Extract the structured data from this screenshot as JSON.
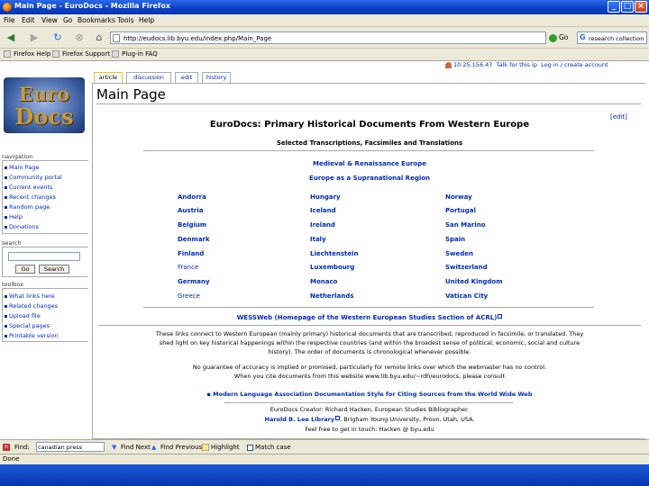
{
  "window": {
    "title": "Main Page - EuroDocs - Mozilla Firefox"
  },
  "menubar": [
    "File",
    "Edit",
    "View",
    "Go",
    "Bookmarks",
    "Tools",
    "Help"
  ],
  "navbar": {
    "url": "http://eudocs.lib.byu.edu/index.php/Main_Page",
    "go_label": "Go",
    "search_value": "research collections"
  },
  "bookmarks": [
    "Firefox Help",
    "Firefox Support",
    "Plug-in FAQ"
  ],
  "userbar": {
    "ip": "10.25.156.47",
    "talk": "Talk for this ip",
    "login": "Log in / create account"
  },
  "tabs": [
    "article",
    "discussion",
    "edit",
    "history"
  ],
  "logo": {
    "line1": "Euro",
    "line2": "Docs"
  },
  "sidebar": {
    "navigation_title": "navigation",
    "navigation": [
      "Main Page",
      "Community portal",
      "Current events",
      "Recent changes",
      "Random page",
      "Help",
      "Donations"
    ],
    "search_title": "search",
    "go_button": "Go",
    "search_button": "Search",
    "toolbox_title": "toolbox",
    "toolbox": [
      "What links here",
      "Related changes",
      "Upload file",
      "Special pages",
      "Printable version"
    ]
  },
  "main": {
    "page_title": "Main Page",
    "edit": "[edit]",
    "heading": "EuroDocs: Primary Historical Documents From Western Europe",
    "subheading": "Selected Transcriptions, Facsimiles and Translations",
    "period_link": "Medieval & Renaissance Europe",
    "supranational_link": "Europe as a Supranational Region",
    "countries": [
      [
        "Andorra",
        "Hungary",
        "Norway"
      ],
      [
        "Austria",
        "Iceland",
        "Portugal"
      ],
      [
        "Belgium",
        "Ireland",
        "San Marino"
      ],
      [
        "Denmark",
        "Italy",
        "Spain"
      ],
      [
        "Finland",
        "Liechtenstein",
        "Sweden"
      ],
      [
        "France",
        "Luxembourg",
        "Switzerland"
      ],
      [
        "Germany",
        "Monaco",
        "United Kingdom"
      ],
      [
        "Greece",
        "Netherlands",
        "Vatican City"
      ]
    ],
    "wess_link": "WESSWeb",
    "wess_text": " (Homepage of the Western European Studies Section of ACRL)",
    "para1": [
      "These links connect to Western European (mainly primary) historical documents that are transcribed, reproduced in facsimile, or translated. They",
      "shed light on key historical happenings within the respective countries (and within the broadest sense of political, economic, social and culture",
      "history). The order of documents is chronological whenever possible."
    ],
    "para2": [
      "No guarantee of accuracy is implied or promised, particularly for remote links over which the webmaster has no control.",
      "When you cite documents from this website www.lib.byu.edu/~rdh/eurodocs, please consult"
    ],
    "mla_link": "Modern Language Association Documentation Style for Citing Sources from the World Wide Web",
    "footer": [
      "EuroDocs Creator: Richard Hacken, European Studies Bibliographer.",
      "Harold B. Lee Library",
      ", Brigham Young University, Provo, Utah, USA.",
      "Feel free to get in touch: Hacken @ byu.edu"
    ]
  },
  "findbar": {
    "label": "Find:",
    "value": "canadian press",
    "next": "Find Next",
    "previous": "Find Previous",
    "highlight": "Highlight",
    "match_case": "Match case"
  },
  "status": "Done"
}
